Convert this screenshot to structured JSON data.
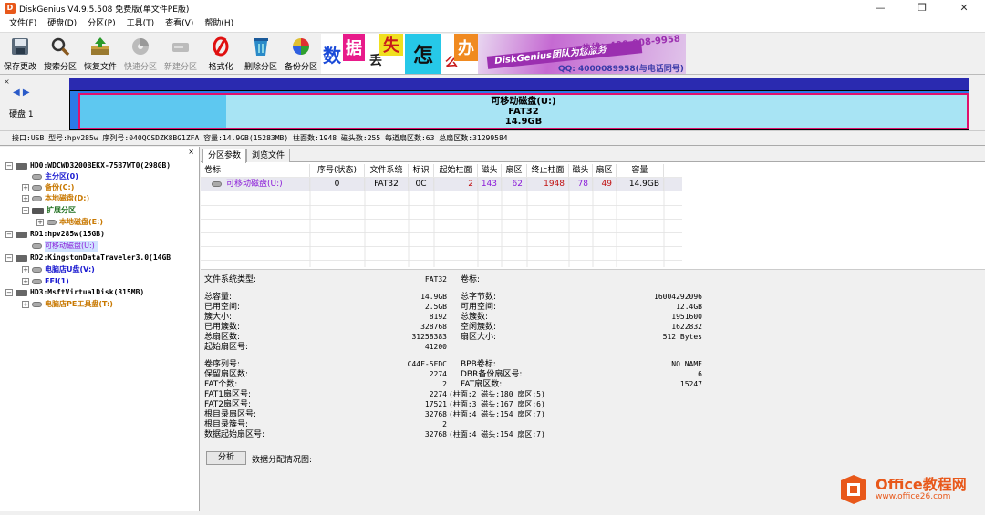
{
  "title": "DiskGenius V4.9.5.508 免费版(单文件PE版)",
  "window_controls": {
    "minimize": "—",
    "maximize": "❐",
    "close": "✕"
  },
  "menu": [
    "文件(F)",
    "硬盘(D)",
    "分区(P)",
    "工具(T)",
    "查看(V)",
    "帮助(H)"
  ],
  "toolbar": [
    {
      "label": "保存更改",
      "icon": "save-icon"
    },
    {
      "label": "搜索分区",
      "icon": "search-icon"
    },
    {
      "label": "恢复文件",
      "icon": "recover-icon"
    },
    {
      "label": "快速分区",
      "icon": "quick-partition-icon"
    },
    {
      "label": "新建分区",
      "icon": "new-partition-icon"
    },
    {
      "label": "格式化",
      "icon": "format-icon"
    },
    {
      "label": "删除分区",
      "icon": "delete-icon"
    },
    {
      "label": "备份分区",
      "icon": "backup-icon"
    }
  ],
  "banner": {
    "chars": [
      "数",
      "据",
      "丢",
      "失",
      "怎",
      "么",
      "办"
    ],
    "brand": "DiskGenius团队为您服务",
    "phone": "热线：400-008-9958",
    "qq": "QQ: 4000089958(与电话同号)"
  },
  "disk_panel": {
    "nav_left": "◀",
    "nav_right": "▶",
    "close": "×",
    "disk_label": "硬盘 1",
    "partition_name": "可移动磁盘(U:)",
    "partition_fs": "FAT32",
    "partition_size": "14.9GB"
  },
  "disk_info": "接口:USB  型号:hpv285w  序列号:040QCSDZK8BG1ZFA  容量:14.9GB(15283MB)  柱面数:1948  磁头数:255  每道扇区数:63  总扇区数:31299584",
  "tree": {
    "close": "×",
    "items": [
      {
        "text": "HD0:WDCWD3200BEKX-75B7WT0(298GB)",
        "style": "disk",
        "level": 0,
        "expander": "−"
      },
      {
        "text": "主分区(0)",
        "style": "navy",
        "level": 1,
        "expander": ""
      },
      {
        "text": "备份(C:)",
        "style": "orange",
        "level": 1,
        "expander": "+"
      },
      {
        "text": "本地磁盘(D:)",
        "style": "orange",
        "level": 1,
        "expander": "+"
      },
      {
        "text": "扩展分区",
        "style": "green",
        "level": 1,
        "expander": "−"
      },
      {
        "text": "本地磁盘(E:)",
        "style": "orange",
        "level": 2,
        "expander": "+"
      },
      {
        "text": "RD1:hpv285w(15GB)",
        "style": "disk",
        "level": 0,
        "expander": "−"
      },
      {
        "text": "可移动磁盘(U:)",
        "style": "sel",
        "level": 1,
        "expander": ""
      },
      {
        "text": "RD2:KingstonDataTraveler3.0(14GB",
        "style": "disk",
        "level": 0,
        "expander": "−"
      },
      {
        "text": "电脑店U盘(V:)",
        "style": "blue",
        "level": 1,
        "expander": "+"
      },
      {
        "text": "EFI(1)",
        "style": "blue",
        "level": 1,
        "expander": "+"
      },
      {
        "text": "HD3:MsftVirtualDisk(315MB)",
        "style": "disk",
        "level": 0,
        "expander": "−"
      },
      {
        "text": "电脑店PE工具盘(T:)",
        "style": "orange",
        "level": 1,
        "expander": "+"
      }
    ]
  },
  "tabs": [
    "分区参数",
    "浏览文件"
  ],
  "partition_table": {
    "headers": [
      "卷标",
      "序号(状态)",
      "文件系统",
      "标识",
      "起始柱面",
      "磁头",
      "扇区",
      "终止柱面",
      "磁头",
      "扇区",
      "容量"
    ],
    "row": [
      "可移动磁盘(U:)",
      "0",
      "FAT32",
      "0C",
      "2",
      "143",
      "62",
      "1948",
      "78",
      "49",
      "14.9GB"
    ]
  },
  "details": {
    "fs_type_label": "文件系统类型:",
    "fs_type_value": "FAT32",
    "volume_label": "卷标:",
    "left_block": [
      {
        "k": "总容量:",
        "v": "14.9GB"
      },
      {
        "k": "已用空间:",
        "v": "2.5GB"
      },
      {
        "k": "簇大小:",
        "v": "8192"
      },
      {
        "k": "已用簇数:",
        "v": "328768"
      },
      {
        "k": "总扇区数:",
        "v": "31258383"
      },
      {
        "k": "起始扇区号:",
        "v": "41200"
      }
    ],
    "right_block": [
      {
        "k": "总字节数:",
        "v": "16004292096"
      },
      {
        "k": "可用空间:",
        "v": "12.4GB"
      },
      {
        "k": "总簇数:",
        "v": "1951600"
      },
      {
        "k": "空闲簇数:",
        "v": "1622832"
      },
      {
        "k": "扇区大小:",
        "v": "512 Bytes"
      }
    ],
    "left_block2": [
      {
        "k": "卷序列号:",
        "v": "C44F-5FDC"
      },
      {
        "k": "保留扇区数:",
        "v": "2274"
      },
      {
        "k": "FAT个数:",
        "v": "2"
      },
      {
        "k": "FAT1扇区号:",
        "v": "2274"
      },
      {
        "k": "FAT2扇区号:",
        "v": "17521"
      },
      {
        "k": "根目录扇区号:",
        "v": "32768"
      },
      {
        "k": "根目录簇号:",
        "v": "2"
      },
      {
        "k": "数据起始扇区号:",
        "v": "32768"
      }
    ],
    "chs_notes": [
      "",
      "",
      "",
      "(柱面:2 磁头:180 扇区:5)",
      "(柱面:3 磁头:167 扇区:6)",
      "(柱面:4 磁头:154 扇区:7)",
      "",
      "(柱面:4 磁头:154 扇区:7)"
    ],
    "right_block2": [
      {
        "k": "BPB卷标:",
        "v": "NO NAME"
      },
      {
        "k": "DBR备份扇区号:",
        "v": "6"
      },
      {
        "k": "FAT扇区数:",
        "v": "15247"
      }
    ],
    "analyze_button": "分析",
    "analyze_label": "数据分配情况图:"
  },
  "watermark": {
    "line1": "Office教程网",
    "line2": "www.office26.com"
  }
}
